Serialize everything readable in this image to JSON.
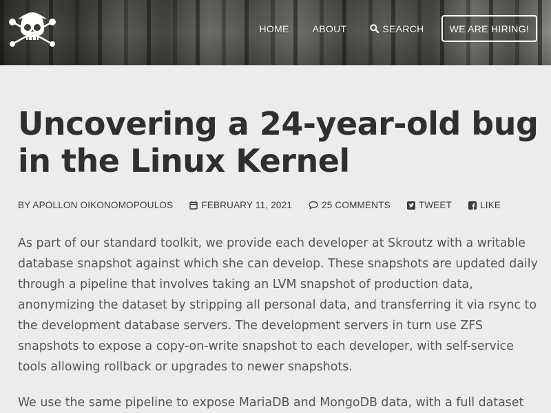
{
  "header": {
    "nav": {
      "home": "HOME",
      "about": "ABOUT",
      "search": "SEARCH",
      "hiring": "WE ARE HIRING!"
    }
  },
  "article": {
    "title": "Uncovering a 24-year-old bug in the Linux Kernel",
    "meta": {
      "author": "BY APOLLON OIKONOMOPOULOS",
      "date": "FEBRUARY 11, 2021",
      "comments": "25 COMMENTS",
      "tweet": "TWEET",
      "like": "LIKE"
    },
    "paragraphs": [
      "As part of our standard toolkit, we provide each developer at Skroutz with a writable database snapshot against which she can develop. These snapshots are updated daily through a pipeline that involves taking an LVM snapshot of production data, anonymizing the dataset by stripping all personal data, and transferring it via rsync to the development database servers. The development servers in turn use ZFS snapshots to expose a copy-on-write snapshot to each developer, with self-service tools allowing rollback or upgrades to newer snapshots.",
      "We use the same pipeline to expose MariaDB and MongoDB data, with a full dataset"
    ]
  },
  "icons": {
    "logo": "skull-crossed-bones-logo",
    "search": "search-icon",
    "calendar": "calendar-icon",
    "comment": "comment-icon",
    "twitter": "twitter-icon",
    "facebook": "facebook-icon"
  },
  "colors": {
    "background": "#ececec",
    "title": "#2f2f2f",
    "body_text": "#555555",
    "nav_text": "#ffffff"
  }
}
